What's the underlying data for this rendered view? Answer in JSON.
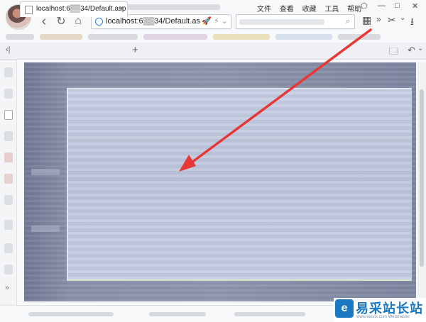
{
  "menu": {
    "items": [
      "文件",
      "查看",
      "收藏",
      "工具",
      "帮助"
    ]
  },
  "window_controls": {
    "minimize": "—",
    "maximize": "□",
    "close": "✕"
  },
  "nav": {
    "back": "‹",
    "forward": "›",
    "refresh": "↻",
    "home": "⌂"
  },
  "address": {
    "url": "localhost:6▒▒34/Default.as",
    "rocket": "🚀",
    "flash": "⚡",
    "dropdown": "⌄"
  },
  "search": {
    "icon": "⌕"
  },
  "tab": {
    "label": "localhost:6▒▒34/Default.asp",
    "close": "×",
    "new_tab": "+"
  },
  "toolbar_right": {
    "apps": "▦",
    "more": "»",
    "cut": "✂",
    "cut_menu": "⌄",
    "download": "⭳"
  },
  "tabrow_right": {
    "save": "🗔",
    "undo": "↶",
    "undo_menu": "⌄"
  },
  "sidebar": {
    "toggle": "‹|",
    "more": "»"
  },
  "watermark": {
    "logo": "e",
    "name": "易采站长站",
    "url": "www.easck.com Webmaster"
  },
  "colors": {
    "arrow": "#e83737",
    "accent": "#1a78c2"
  }
}
